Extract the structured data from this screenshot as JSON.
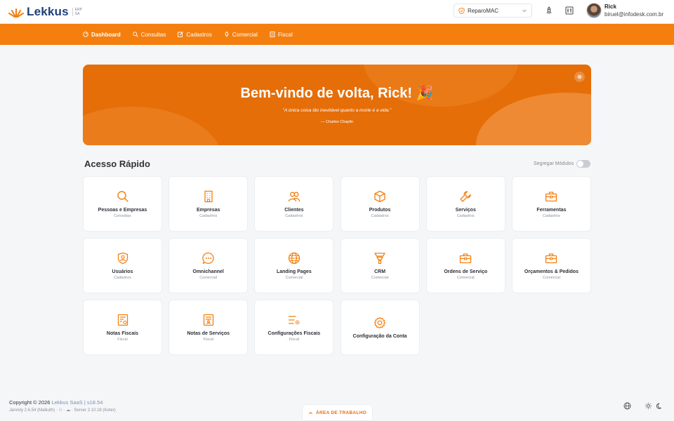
{
  "header": {
    "brand": "Lekkus",
    "brand_sub_1": "ERP",
    "brand_sub_2": "SA",
    "workspace": "ReparoMAC",
    "user_name": "Rick",
    "user_email": "biruel@infodesk.com.br"
  },
  "nav": {
    "items": [
      {
        "label": "Dashboard",
        "icon": "dashboard-icon"
      },
      {
        "label": "Consultas",
        "icon": "search-icon"
      },
      {
        "label": "Cadastros",
        "icon": "edit-icon"
      },
      {
        "label": "Comercial",
        "icon": "bulb-icon"
      },
      {
        "label": "Fiscal",
        "icon": "document-icon"
      }
    ]
  },
  "hero": {
    "title": "Bem-vindo de volta, Rick! 🎉",
    "quote": "\"A única coisa tão inevitável quanto a morte é a vida.\"",
    "author": "— Charles Chaplin"
  },
  "quick_access": {
    "title": "Acesso Rápido",
    "toggle_label": "Segregar Módulos",
    "cards": [
      {
        "title": "Pessoas e Empresas",
        "subtitle": "Consultas",
        "icon": "search-icon"
      },
      {
        "title": "Empresas",
        "subtitle": "Cadastros",
        "icon": "building-icon"
      },
      {
        "title": "Clientes",
        "subtitle": "Cadastros",
        "icon": "users-icon"
      },
      {
        "title": "Produtos",
        "subtitle": "Cadastros",
        "icon": "box-icon"
      },
      {
        "title": "Serviços",
        "subtitle": "Cadastros",
        "icon": "wrench-icon"
      },
      {
        "title": "Ferramentas",
        "subtitle": "Cadastros",
        "icon": "toolbox-icon"
      },
      {
        "title": "Usuários",
        "subtitle": "Cadastros",
        "icon": "user-shield-icon"
      },
      {
        "title": "Omnichannel",
        "subtitle": "Comercial",
        "icon": "chat-icon"
      },
      {
        "title": "Landing Pages",
        "subtitle": "Comercial",
        "icon": "globe-icon"
      },
      {
        "title": "CRM",
        "subtitle": "Comercial",
        "icon": "funnel-icon"
      },
      {
        "title": "Ordens de Serviço",
        "subtitle": "Comercial",
        "icon": "briefcase-icon"
      },
      {
        "title": "Orçamentos & Pedidos",
        "subtitle": "Comercial",
        "icon": "briefcase-icon"
      },
      {
        "title": "Notas Fiscais",
        "subtitle": "Fiscal",
        "icon": "invoice-icon"
      },
      {
        "title": "Notas de Serviços",
        "subtitle": "Fiscal",
        "icon": "service-invoice-icon"
      },
      {
        "title": "Configurações Fiscais",
        "subtitle": "Fiscal",
        "icon": "settings-list-icon"
      },
      {
        "title": "Configuração da Conta",
        "subtitle": "",
        "icon": "gear-icon"
      }
    ]
  },
  "footer": {
    "copyright": "Copyright © 2026",
    "product_link": "Lekkus SaaS | s18.54",
    "version_line": "Jarvisly 2.6.54 (Malkuth) · ⚇ · ☁ · Server 2.10.18 (Keter)",
    "worktab_label": "ÁREA DE TRABALHO"
  },
  "colors": {
    "accent": "#f47f0e",
    "hero": "#e56e08",
    "brand": "#1f3f7a"
  }
}
